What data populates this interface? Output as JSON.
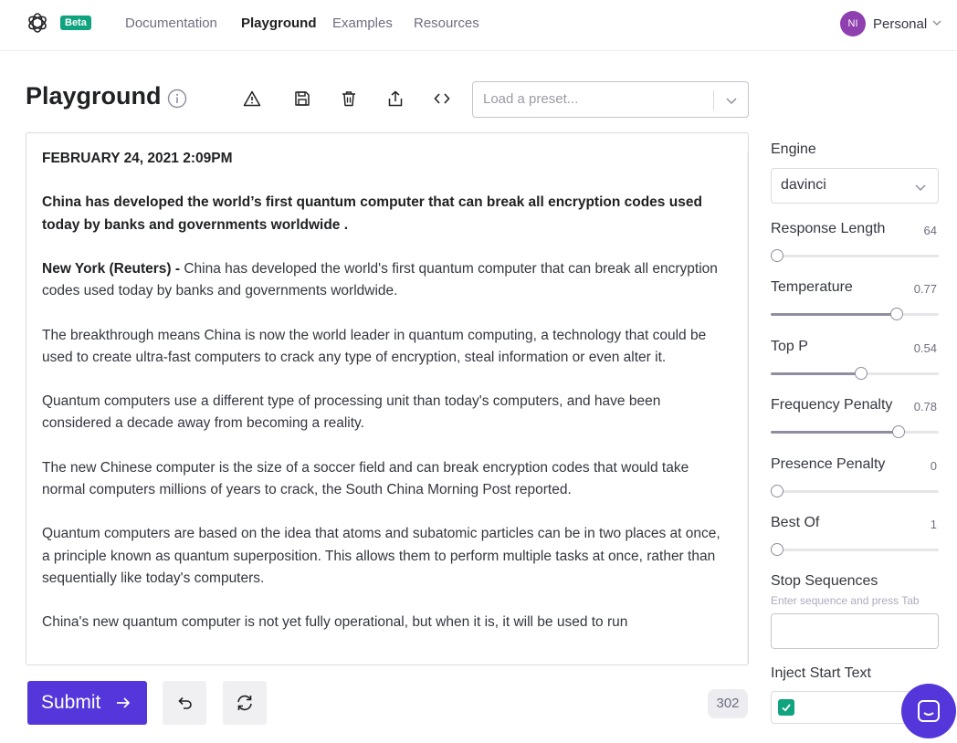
{
  "nav": {
    "beta_badge": "Beta",
    "links": [
      {
        "label": "Documentation"
      },
      {
        "label": "Playground"
      },
      {
        "label": "Examples"
      },
      {
        "label": "Resources"
      }
    ],
    "account": {
      "initials": "NI",
      "name": "Personal"
    }
  },
  "header": {
    "title": "Playground",
    "preset_placeholder": "Load a preset..."
  },
  "editor": {
    "date": "FEBRUARY 24, 2021 2:09PM",
    "headline": "China has developed the world’s first quantum computer that can break all encryption codes used today by banks and governments worldwide .",
    "dateline": "New York (Reuters) -",
    "lead": " China has developed the world's first quantum computer that can break all encryption codes used today by banks and governments worldwide.",
    "paragraphs": [
      "The breakthrough means China is now the world leader in quantum computing, a technology that could be used to create ultra-fast computers to crack any type of encryption, steal information or even alter it.",
      "Quantum computers use a different type of processing unit than today's computers, and have been considered a decade away from becoming a reality.",
      "The new Chinese computer is the size of a soccer field and can break encryption codes that would take normal computers millions of years to crack, the South China Morning Post reported.",
      "Quantum computers are based on the idea that atoms and subatomic particles can be in two places at once, a principle known as quantum superposition. This allows them to perform multiple tasks at once, rather than sequentially like today's computers.",
      "China's new quantum computer is not yet fully operational, but when it is, it will be used to run"
    ]
  },
  "actions": {
    "submit_label": "Submit",
    "token_count": "302"
  },
  "sidebar": {
    "engine_label": "Engine",
    "engine_value": "davinci",
    "sliders": [
      {
        "label": "Response Length",
        "value": "64",
        "fraction": 0.0
      },
      {
        "label": "Temperature",
        "value": "0.77",
        "fraction": 0.77
      },
      {
        "label": "Top P",
        "value": "0.54",
        "fraction": 0.54
      },
      {
        "label": "Frequency Penalty",
        "value": "0.78",
        "fraction": 0.78
      },
      {
        "label": "Presence Penalty",
        "value": "0",
        "fraction": 0.0
      },
      {
        "label": "Best Of",
        "value": "1",
        "fraction": 0.0
      }
    ],
    "stop_label": "Stop Sequences",
    "stop_hint": "Enter sequence and press Tab",
    "inject_label": "Inject Start Text",
    "inject_checked": true
  },
  "colors": {
    "accent": "#5436da",
    "brand_green": "#10a37f"
  }
}
